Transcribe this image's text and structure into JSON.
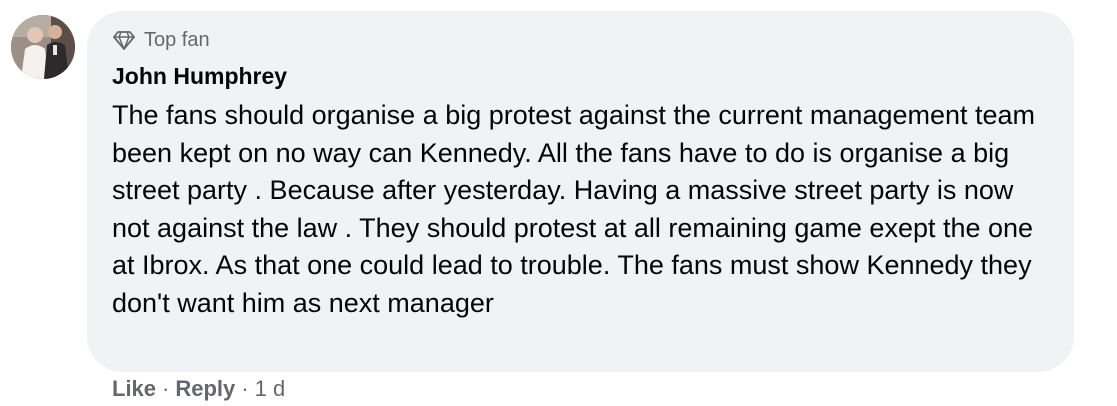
{
  "comment": {
    "badge": "Top fan",
    "badge_icon": "diamond-icon",
    "author": "John Humphrey",
    "text": "The fans should organise a big protest against the current management team been kept on no way can Kennedy. All the fans have to do is organise a big street party . Because after yesterday. Having a massive street party is now not against the law . They should protest at all remaining game exept the one at Ibrox. As that one could lead to trouble. The fans must show Kennedy they don't want him as next manager"
  },
  "actions": {
    "like": "Like",
    "separator": "·",
    "reply": "Reply",
    "time": "1 d"
  },
  "colors": {
    "bubble_bg": "#f0f2f5",
    "secondary_text": "#65676b",
    "primary_text": "#050505"
  }
}
